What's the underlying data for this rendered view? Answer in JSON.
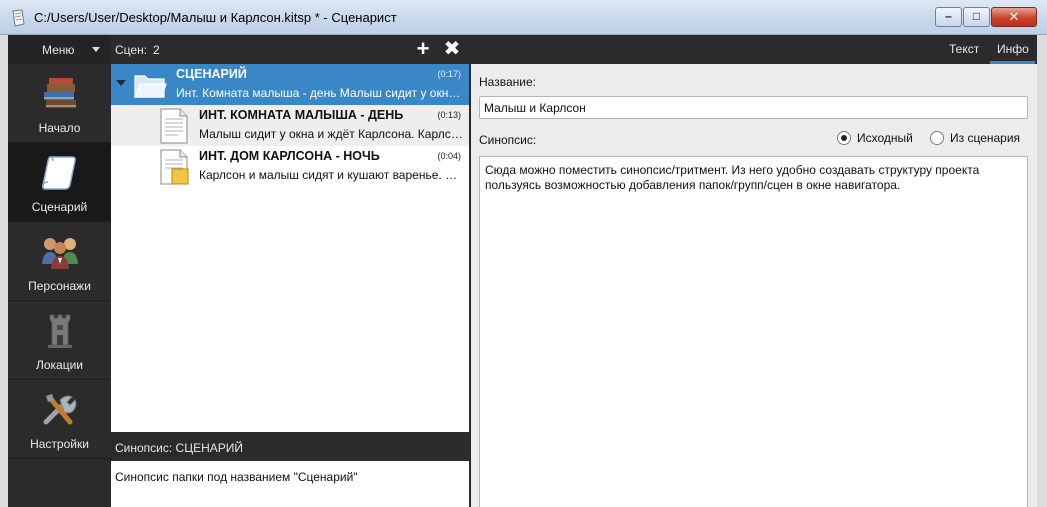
{
  "window": {
    "title": "C:/Users/User/Desktop/Малыш и Карлсон.kitsp * - Сценарист",
    "minimize": "–",
    "maximize": "□",
    "close": "✕"
  },
  "sidebar": {
    "menu_label": "Меню",
    "items": [
      {
        "label": "Начало",
        "icon": "books-icon"
      },
      {
        "label": "Сценарий",
        "icon": "scroll-icon"
      },
      {
        "label": "Персонажи",
        "icon": "people-icon"
      },
      {
        "label": "Локации",
        "icon": "castle-tower-icon"
      },
      {
        "label": "Настройки",
        "icon": "tools-icon"
      }
    ],
    "active_index": 1
  },
  "navigator": {
    "scenes_label": "Сцен:",
    "scenes_count": "2",
    "add_label": "+",
    "remove_label": "✖",
    "rows": [
      {
        "type": "folder",
        "name": "СЦЕНАРИЙ",
        "duration": "(0:17)",
        "description": "Инт. Комната малыша - день Малыш сидит у окна и ждёт Карлсона"
      },
      {
        "type": "scene",
        "name": "ИНТ. КОМНАТА МАЛЫША - ДЕНЬ",
        "duration": "(0:13)",
        "description": "Малыш сидит у окна и ждёт Карлсона. Карлсон прилетает"
      },
      {
        "type": "scene",
        "name": "ИНТ. ДОМ КАРЛСОНА - НОЧЬ",
        "duration": "(0:04)",
        "description": "Карлсон и малыш сидят и кушают варенье. Малыш доволен"
      }
    ],
    "synopsis_header": "Синопсис: СЦЕНАРИЙ",
    "synopsis_text": "Синопсис папки под названием \"Сценарий\""
  },
  "info_panel": {
    "tab_text": "Текст",
    "tab_info": "Инфо",
    "name_label": "Название:",
    "name_value": "Малыш и Карлсон",
    "synopsis_label": "Синопсис:",
    "radio_original": "Исходный",
    "radio_from_script": "Из сценария",
    "synopsis_text": "Сюда можно поместить синопсис/тритмент. Из него удобно создавать структуру проекта пользуясь возможностью добавления папок/групп/сцен в окне навигатора."
  },
  "colors": {
    "accent": "#3a87c8",
    "dark_panel": "#2b2b2b"
  }
}
